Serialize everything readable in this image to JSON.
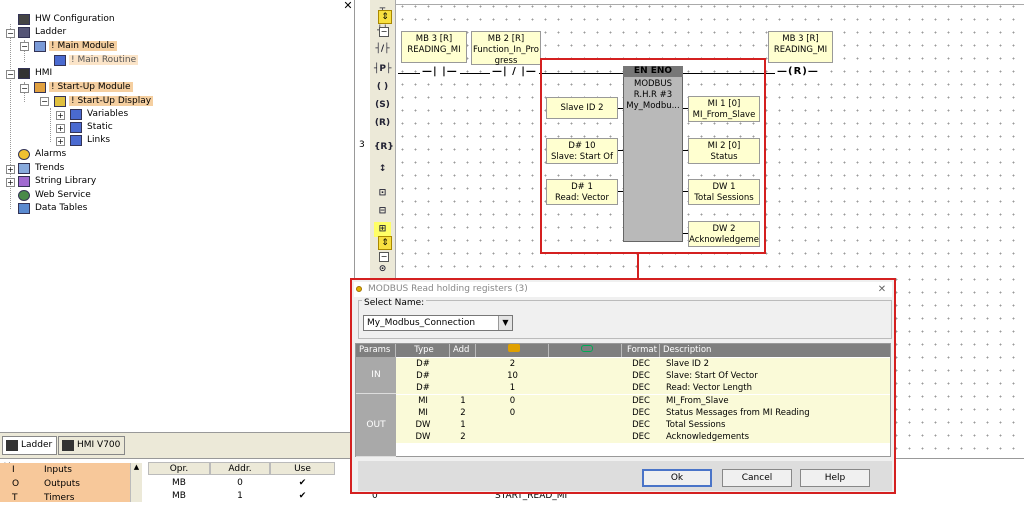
{
  "tree": {
    "items": [
      {
        "label": "HW Configuration"
      },
      {
        "label": "Ladder"
      },
      {
        "label": "! Main Module"
      },
      {
        "label": "! Main Routine"
      },
      {
        "label": "HMI"
      },
      {
        "label": "! Start-Up Module"
      },
      {
        "label": "! Start-Up Display"
      },
      {
        "label": "Variables"
      },
      {
        "label": "Static"
      },
      {
        "label": "Links"
      },
      {
        "label": "Alarms"
      },
      {
        "label": "Trends"
      },
      {
        "label": "String Library"
      },
      {
        "label": "Web Service"
      },
      {
        "label": "Data Tables"
      }
    ],
    "close": "✕"
  },
  "tabs": [
    {
      "label": "Ladder"
    },
    {
      "label": "HMI V700"
    }
  ],
  "bottom_list": {
    "close": "✕",
    "items": [
      {
        "key": "I",
        "label": "Inputs"
      },
      {
        "key": "O",
        "label": "Outputs"
      },
      {
        "key": "T",
        "label": "Timers"
      }
    ],
    "headers": {
      "opr": "Opr.",
      "addr": "Addr.",
      "use": "Use"
    },
    "rows": [
      {
        "opr": "MB",
        "addr": "0",
        "use": "✔"
      },
      {
        "opr": "MB",
        "addr": "1",
        "use": "✔"
      }
    ],
    "extra_num": "0",
    "extra_text": "START_READ_MI"
  },
  "rung_number": "3",
  "toolbar": [
    "┬",
    "┤├",
    "┤/├",
    "┤P├",
    "(  )",
    "(S)",
    "(R)",
    "{R}",
    "↕",
    "⊡",
    "⊟",
    "⊞",
    "⊠",
    "⊙",
    "⊘"
  ],
  "ladder": {
    "coil_top_left": "MB 3 [R]\nREADING_MI",
    "coil_top_mid": "MB 2 [R]\nFunction_In_Pro\ngress",
    "coil_top_right": "MB 3 [R]\nREADING_MI",
    "coil_right_symbol": "—(R)—",
    "contact_left": "—|  |—",
    "contact_mid": "—| / |—",
    "fb": {
      "en_eno": "EN  ENO",
      "name": "MODBUS\nR.H.R #3\nMy_Modbu...",
      "in_params": [
        "Slave ID 2",
        "D# 10\nSlave: Start Of",
        "D# 1\nRead: Vector"
      ],
      "out_params": [
        "MI 1 [0]\nMI_From_Slave",
        "MI 2 [0]\nStatus",
        "DW 1\nTotal Sessions",
        "DW 2\nAcknowledgeme"
      ]
    }
  },
  "dialog": {
    "title": "MODBUS Read holding registers (3)",
    "close": "✕",
    "select_label": "Select Name:",
    "select_value": "My_Modbus_Connection",
    "columns": {
      "params": "Params",
      "type": "Type",
      "add": "Add",
      "v1": "",
      "v2": "",
      "format": "Format",
      "desc": "Description"
    },
    "groups": {
      "in": "IN",
      "out": "OUT"
    },
    "rows": [
      {
        "type": "D#",
        "add": "",
        "v1": "2",
        "v2": "",
        "format": "DEC",
        "desc": "Slave ID 2"
      },
      {
        "type": "D#",
        "add": "",
        "v1": "10",
        "v2": "",
        "format": "DEC",
        "desc": "Slave: Start Of Vector"
      },
      {
        "type": "D#",
        "add": "",
        "v1": "1",
        "v2": "",
        "format": "DEC",
        "desc": "Read: Vector Length"
      },
      {
        "type": "MI",
        "add": "1",
        "v1": "0",
        "v2": "",
        "format": "DEC",
        "desc": "MI_From_Slave"
      },
      {
        "type": "MI",
        "add": "2",
        "v1": "0",
        "v2": "",
        "format": "DEC",
        "desc": "Status Messages from MI Reading"
      },
      {
        "type": "DW",
        "add": "1",
        "v1": "",
        "v2": "",
        "format": "DEC",
        "desc": "Total Sessions"
      },
      {
        "type": "DW",
        "add": "2",
        "v1": "",
        "v2": "",
        "format": "DEC",
        "desc": "Acknowledgements"
      }
    ],
    "buttons": {
      "ok": "Ok",
      "cancel": "Cancel",
      "help": "Help"
    }
  }
}
